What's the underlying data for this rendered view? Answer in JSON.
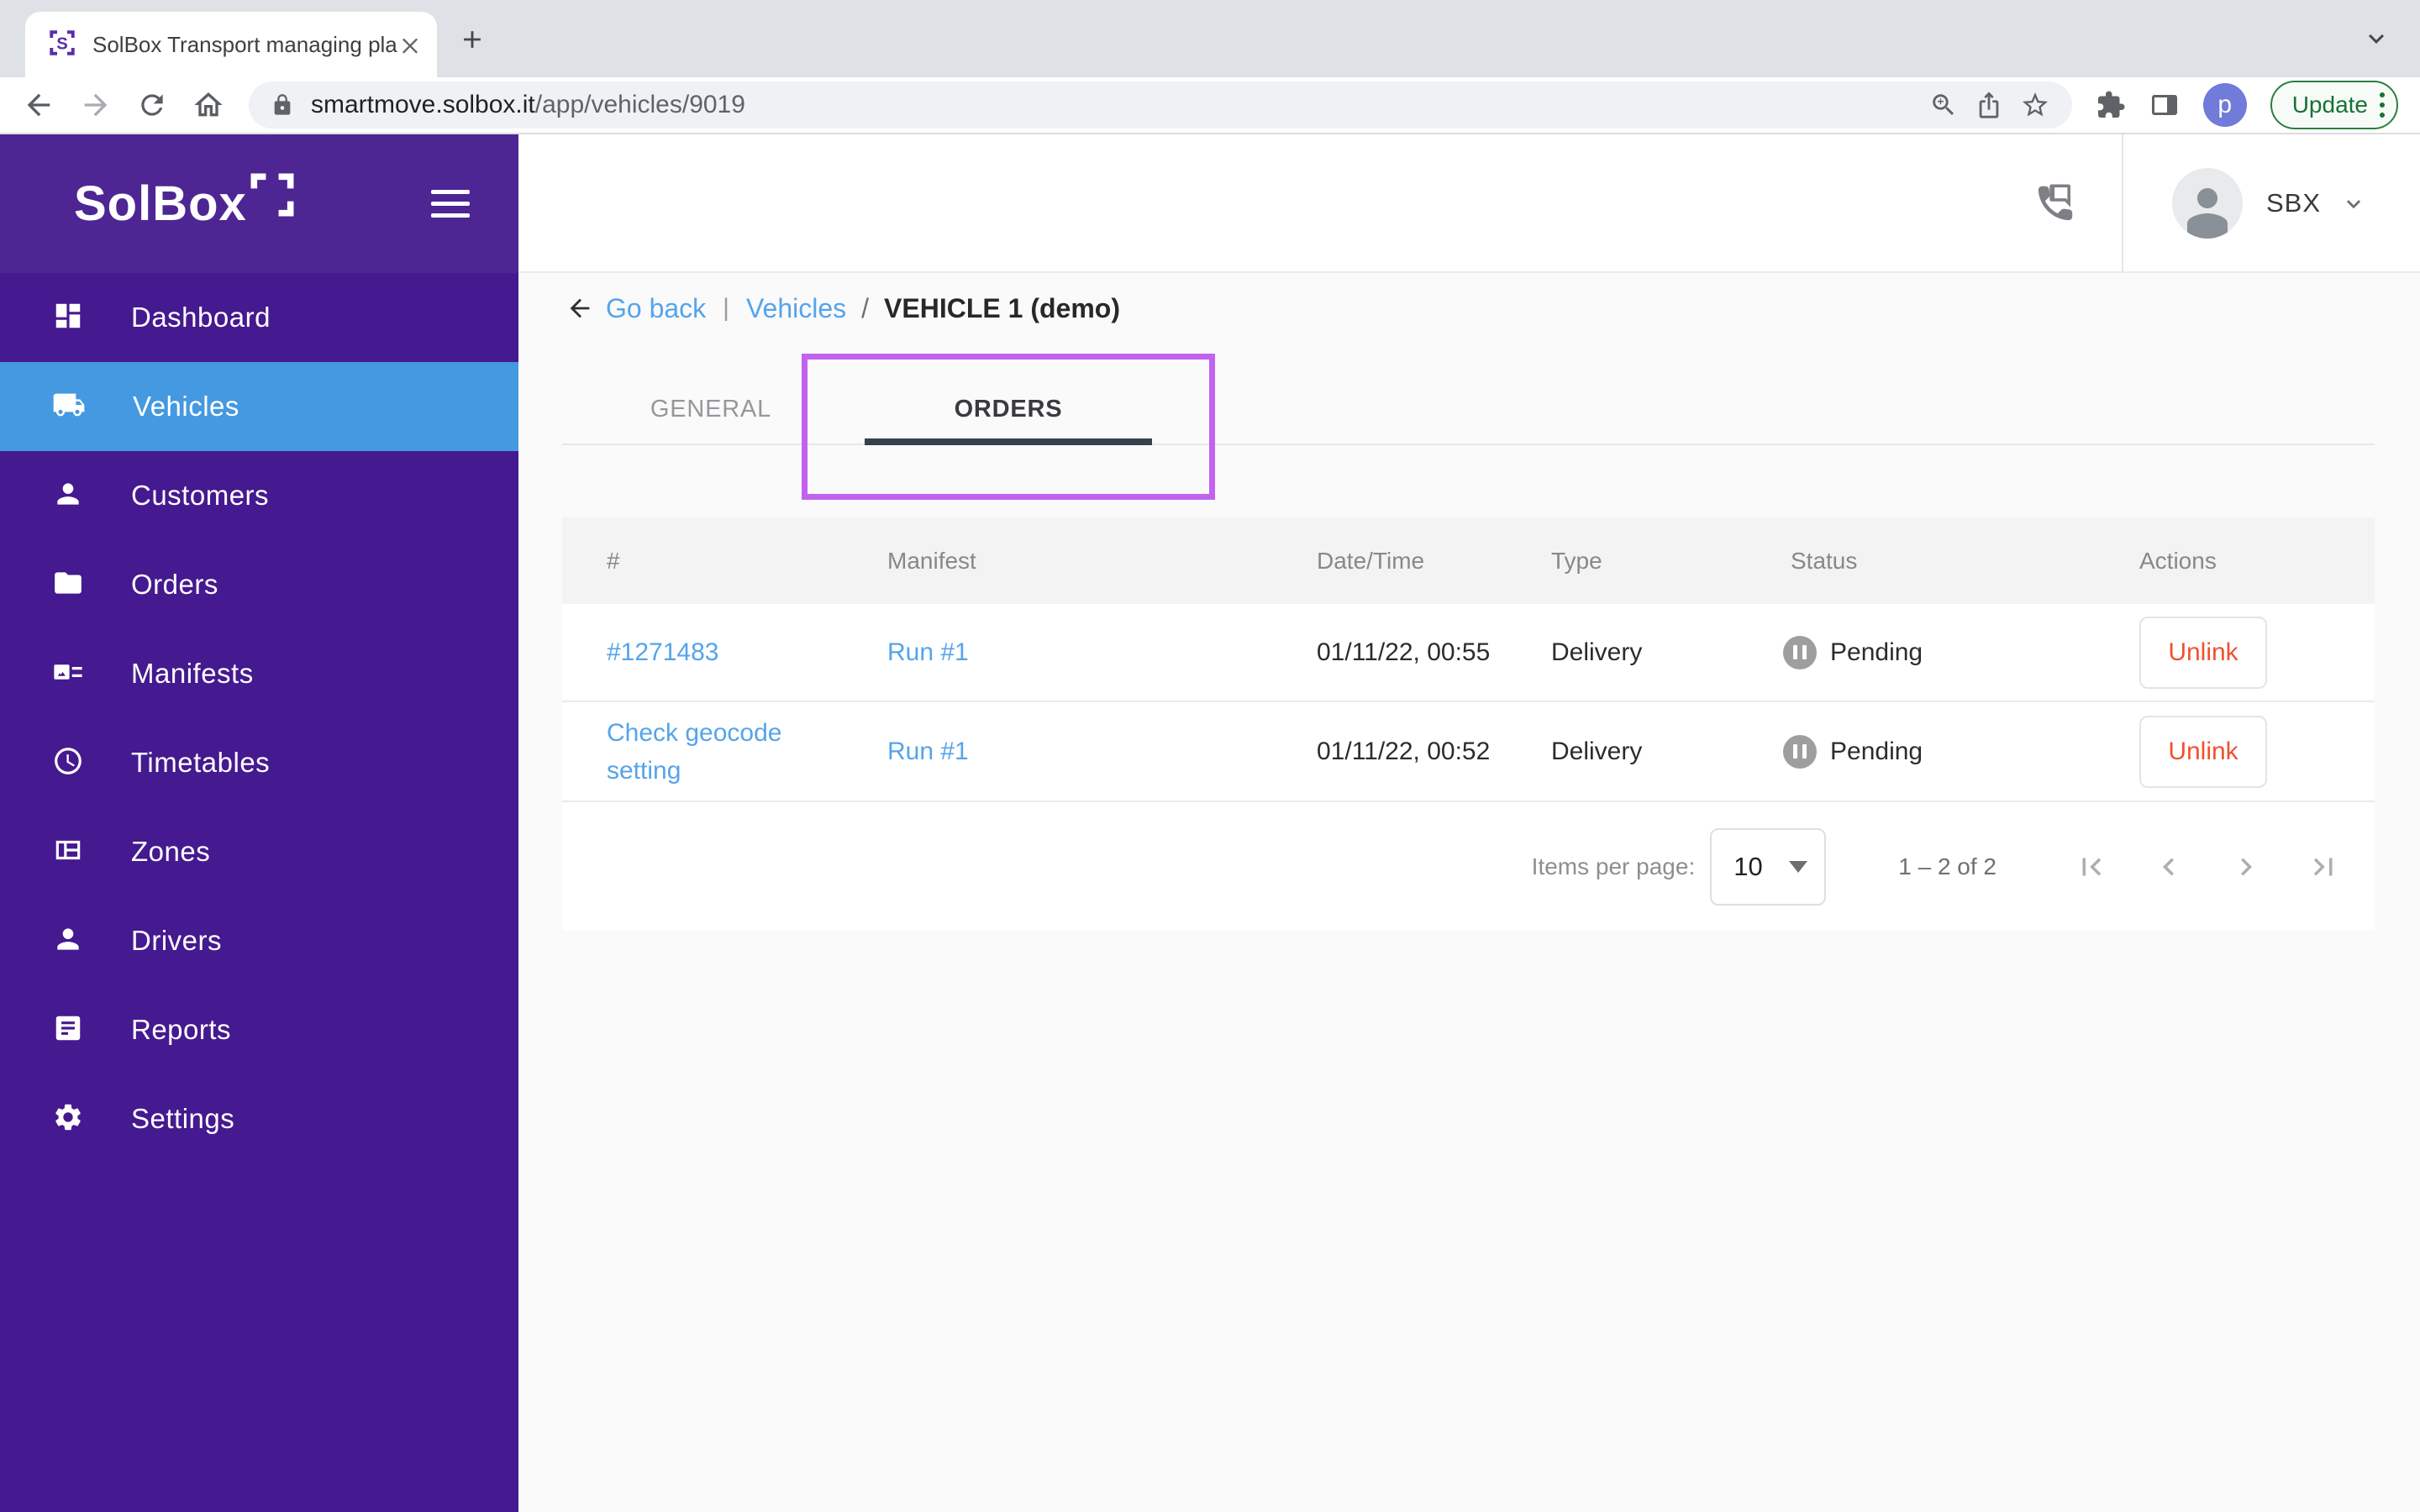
{
  "browser": {
    "tab_title": "SolBox Transport managing pla",
    "url": {
      "host": "smartmove.solbox.it",
      "path": "/app/vehicles/9019"
    },
    "profile_initial": "p",
    "update_label": "Update"
  },
  "app_header": {
    "logo_text": "SolBox",
    "account_label": "SBX"
  },
  "sidebar": {
    "items": [
      {
        "label": "Dashboard",
        "icon": "dashboard-icon",
        "active": false
      },
      {
        "label": "Vehicles",
        "icon": "truck-icon",
        "active": true
      },
      {
        "label": "Customers",
        "icon": "person-icon",
        "active": false
      },
      {
        "label": "Orders",
        "icon": "folder-icon",
        "active": false
      },
      {
        "label": "Manifests",
        "icon": "manifest-icon",
        "active": false
      },
      {
        "label": "Timetables",
        "icon": "clock-icon",
        "active": false
      },
      {
        "label": "Zones",
        "icon": "zones-grid-icon",
        "active": false
      },
      {
        "label": "Drivers",
        "icon": "person-icon",
        "active": false
      },
      {
        "label": "Reports",
        "icon": "report-icon",
        "active": false
      },
      {
        "label": "Settings",
        "icon": "gear-icon",
        "active": false
      }
    ]
  },
  "breadcrumb": {
    "back_label": "Go back",
    "separator": "|",
    "parent": "Vehicles",
    "slash": "/",
    "current": "VEHICLE 1 (demo)"
  },
  "tabs": [
    {
      "label": "GENERAL",
      "active": false
    },
    {
      "label": "ORDERS",
      "active": true
    }
  ],
  "table": {
    "columns": [
      "#",
      "Manifest",
      "Date/Time",
      "Type",
      "Status",
      "Actions"
    ],
    "rows": [
      {
        "order": "#1271483",
        "manifest": "Run #1",
        "datetime": "01/11/22, 00:55",
        "type": "Delivery",
        "status": "Pending",
        "action": "Unlink"
      },
      {
        "order": "Check geocode setting",
        "manifest": "Run #1",
        "datetime": "01/11/22, 00:52",
        "type": "Delivery",
        "status": "Pending",
        "action": "Unlink"
      }
    ]
  },
  "pagination": {
    "items_per_page_label": "Items per page:",
    "page_size": "10",
    "range": "1 – 2 of 2"
  },
  "colors": {
    "sidebar_purple": "#45198F",
    "sidebar_top_purple": "#4D2694",
    "active_item_blue": "#4499E0",
    "link_blue": "#55A4EA",
    "annotation_purple": "#C263F0",
    "unlink_red": "#F1502F",
    "pending_grey": "#9E9E9E",
    "tab_underline": "#37404E",
    "update_green": "#187233",
    "profile_indigo": "#717BD9"
  }
}
